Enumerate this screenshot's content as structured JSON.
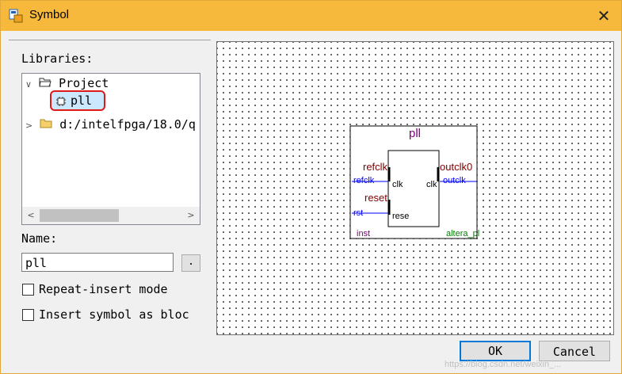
{
  "window": {
    "title": "Symbol",
    "close_glyph": "✕"
  },
  "libraries": {
    "label": "Libraries:",
    "tree": [
      {
        "label": "Project",
        "expanded": true,
        "icon": "folder-open-icon"
      },
      {
        "label": "pll",
        "icon": "symbol-chip-icon",
        "selected": true
      },
      {
        "label": "d:/intelfpga/18.0/q",
        "expanded": false,
        "icon": "folder-icon"
      }
    ],
    "scroll_left": "<",
    "scroll_right": ">"
  },
  "name": {
    "label": "Name:",
    "value": "pll",
    "browse_label": "."
  },
  "options": [
    {
      "label": "Repeat-insert mode",
      "checked": false
    },
    {
      "label": "Insert symbol as bloc",
      "checked": false
    }
  ],
  "symbol": {
    "title": "pll",
    "left_ports": [
      {
        "group": "refclk",
        "name": "refclk",
        "pin": "clk"
      },
      {
        "group": "reset",
        "name": "rst",
        "pin": "rese"
      }
    ],
    "right_ports": [
      {
        "group": "outclk0",
        "name": "outclk",
        "pin": "clk"
      }
    ],
    "instance": "inst",
    "vendor": "altera_pl",
    "colors": {
      "title": "#800080",
      "group": "#800000",
      "wire": "#0000ff",
      "vendor": "#008000",
      "instance": "#800080"
    }
  },
  "buttons": {
    "ok": "OK",
    "cancel": "Cancel"
  },
  "watermark": "https://blog.csdn.net/weixin_..."
}
